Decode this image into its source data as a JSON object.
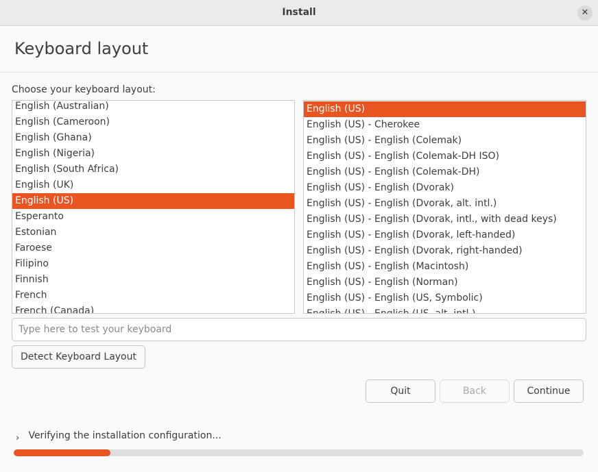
{
  "window": {
    "title": "Install",
    "close_icon": "close-icon"
  },
  "header": {
    "title": "Keyboard layout"
  },
  "prompt": "Choose your keyboard layout:",
  "layouts": {
    "items": [
      "English (Australian)",
      "English (Cameroon)",
      "English (Ghana)",
      "English (Nigeria)",
      "English (South Africa)",
      "English (UK)",
      "English (US)",
      "Esperanto",
      "Estonian",
      "Faroese",
      "Filipino",
      "Finnish",
      "French",
      "French (Canada)"
    ],
    "selected": "English (US)"
  },
  "variants": {
    "items": [
      "English (US)",
      "English (US) - Cherokee",
      "English (US) - English (Colemak)",
      "English (US) - English (Colemak-DH ISO)",
      "English (US) - English (Colemak-DH)",
      "English (US) - English (Dvorak)",
      "English (US) - English (Dvorak, alt. intl.)",
      "English (US) - English (Dvorak, intl., with dead keys)",
      "English (US) - English (Dvorak, left-handed)",
      "English (US) - English (Dvorak, right-handed)",
      "English (US) - English (Macintosh)",
      "English (US) - English (Norman)",
      "English (US) - English (US, Symbolic)",
      "English (US) - English (US, alt. intl.)"
    ],
    "selected": "English (US)"
  },
  "test_field": {
    "placeholder": "Type here to test your keyboard",
    "value": ""
  },
  "buttons": {
    "detect": "Detect Keyboard Layout",
    "quit": "Quit",
    "back": "Back",
    "continue": "Continue"
  },
  "status": {
    "chevron_icon": "chevron-right-icon",
    "text": "Verifying the installation configuration...",
    "progress": 0.17
  },
  "colors": {
    "accent": "#e95420",
    "titlebar": "#ebebeb",
    "background": "#fafafa"
  }
}
